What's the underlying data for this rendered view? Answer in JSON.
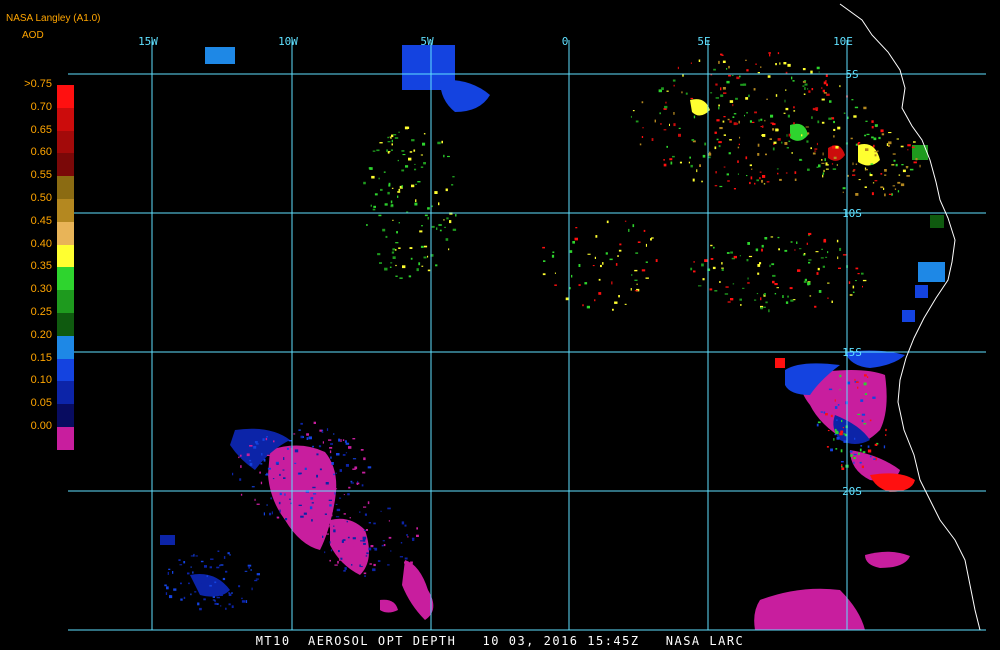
{
  "header": {
    "source": "NASA Langley (A1.0)",
    "variable": "AOD"
  },
  "legend": {
    "labels": [
      ">0.75",
      "0.70",
      "0.65",
      "0.60",
      "0.55",
      "0.50",
      "0.45",
      "0.40",
      "0.35",
      "0.30",
      "0.25",
      "0.20",
      "0.15",
      "0.10",
      "0.05",
      "0.00"
    ],
    "colors": [
      "#ff1010",
      "#cc0c0c",
      "#a30a0a",
      "#7a0808",
      "#8b6b12",
      "#b48820",
      "#e8b458",
      "#ffff30",
      "#2ed42e",
      "#1e9a1e",
      "#0f5a0f",
      "#1e88e6",
      "#1443e0",
      "#0c24a8",
      "#080c60",
      "#c81e9e"
    ]
  },
  "grid": {
    "lon_labels": [
      "15W",
      "10W",
      "5W",
      "0",
      "5E",
      "10E"
    ],
    "lat_labels": [
      "5S",
      "10S",
      "15S",
      "20S"
    ]
  },
  "footer": {
    "text": "MT10  AEROSOL OPT DEPTH   10 03, 2016 15:45Z   NASA LARC"
  }
}
